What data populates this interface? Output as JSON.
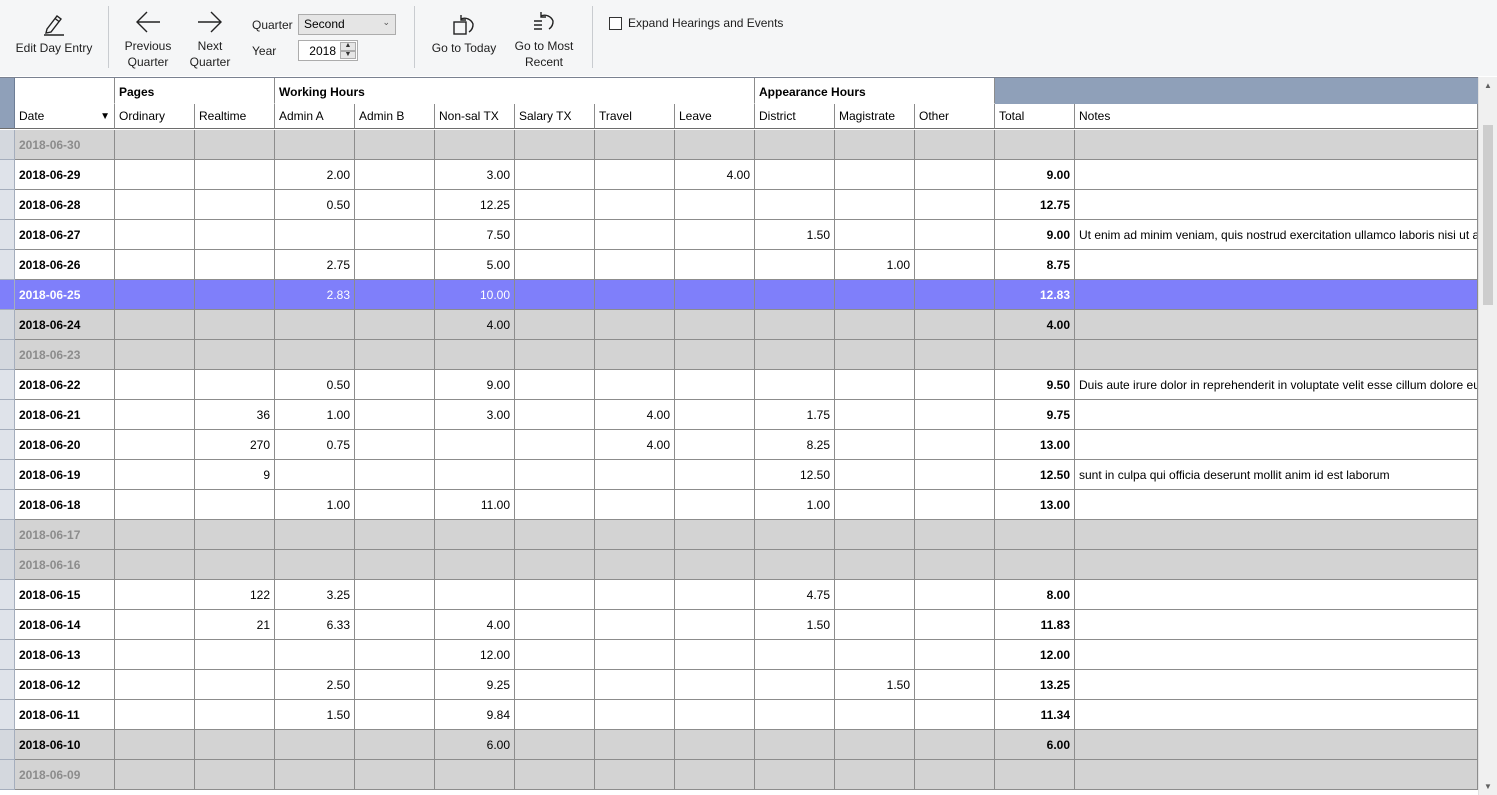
{
  "toolbar": {
    "edit_day_entry": "Edit Day Entry",
    "previous_quarter": "Previous\nQuarter",
    "next_quarter": "Next\nQuarter",
    "quarter_label": "Quarter",
    "quarter_value": "Second",
    "year_label": "Year",
    "year_value": "2018",
    "go_to_today": "Go to Today",
    "go_to_most_recent": "Go to Most\nRecent",
    "expand_label": "Expand Hearings and Events",
    "expand_checked": false
  },
  "groups": {
    "pages": "Pages",
    "working_hours": "Working Hours",
    "appearance_hours": "Appearance Hours"
  },
  "columns": {
    "date": "Date",
    "ordinary": "Ordinary",
    "realtime": "Realtime",
    "admin_a": "Admin A",
    "admin_b": "Admin B",
    "nonsal_tx": "Non-sal TX",
    "salary_tx": "Salary TX",
    "travel": "Travel",
    "leave": "Leave",
    "district": "District",
    "magistrate": "Magistrate",
    "other": "Other",
    "total": "Total",
    "notes": "Notes"
  },
  "colors": {
    "selected_row": "#7f7ffa",
    "weekend_row": "#d3d3d3",
    "group_header_fill": "#8fa0b9"
  },
  "rows": [
    {
      "date": "2018-06-30",
      "weekend": true,
      "empty": true,
      "ordinary": "",
      "realtime": "",
      "admin_a": "",
      "admin_b": "",
      "nonsal_tx": "",
      "salary_tx": "",
      "travel": "",
      "leave": "",
      "district": "",
      "magistrate": "",
      "other": "",
      "total": "",
      "notes": ""
    },
    {
      "date": "2018-06-29",
      "weekend": false,
      "ordinary": "",
      "realtime": "",
      "admin_a": "2.00",
      "admin_b": "",
      "nonsal_tx": "3.00",
      "salary_tx": "",
      "travel": "",
      "leave": "4.00",
      "district": "",
      "magistrate": "",
      "other": "",
      "total": "9.00",
      "notes": ""
    },
    {
      "date": "2018-06-28",
      "weekend": false,
      "ordinary": "",
      "realtime": "",
      "admin_a": "0.50",
      "admin_b": "",
      "nonsal_tx": "12.25",
      "salary_tx": "",
      "travel": "",
      "leave": "",
      "district": "",
      "magistrate": "",
      "other": "",
      "total": "12.75",
      "notes": ""
    },
    {
      "date": "2018-06-27",
      "weekend": false,
      "ordinary": "",
      "realtime": "",
      "admin_a": "",
      "admin_b": "",
      "nonsal_tx": "7.50",
      "salary_tx": "",
      "travel": "",
      "leave": "",
      "district": "1.50",
      "magistrate": "",
      "other": "",
      "total": "9.00",
      "notes": "Ut enim ad minim veniam, quis nostrud exercitation ullamco laboris nisi ut aliquip ex ea commodo consequat"
    },
    {
      "date": "2018-06-26",
      "weekend": false,
      "ordinary": "",
      "realtime": "",
      "admin_a": "2.75",
      "admin_b": "",
      "nonsal_tx": "5.00",
      "salary_tx": "",
      "travel": "",
      "leave": "",
      "district": "",
      "magistrate": "1.00",
      "other": "",
      "total": "8.75",
      "notes": ""
    },
    {
      "date": "2018-06-25",
      "weekend": false,
      "selected": true,
      "ordinary": "",
      "realtime": "",
      "admin_a": "2.83",
      "admin_b": "",
      "nonsal_tx": "10.00",
      "salary_tx": "",
      "travel": "",
      "leave": "",
      "district": "",
      "magistrate": "",
      "other": "",
      "total": "12.83",
      "notes": ""
    },
    {
      "date": "2018-06-24",
      "weekend": true,
      "ordinary": "",
      "realtime": "",
      "admin_a": "",
      "admin_b": "",
      "nonsal_tx": "4.00",
      "salary_tx": "",
      "travel": "",
      "leave": "",
      "district": "",
      "magistrate": "",
      "other": "",
      "total": "4.00",
      "notes": ""
    },
    {
      "date": "2018-06-23",
      "weekend": true,
      "empty": true,
      "ordinary": "",
      "realtime": "",
      "admin_a": "",
      "admin_b": "",
      "nonsal_tx": "",
      "salary_tx": "",
      "travel": "",
      "leave": "",
      "district": "",
      "magistrate": "",
      "other": "",
      "total": "",
      "notes": ""
    },
    {
      "date": "2018-06-22",
      "weekend": false,
      "ordinary": "",
      "realtime": "",
      "admin_a": "0.50",
      "admin_b": "",
      "nonsal_tx": "9.00",
      "salary_tx": "",
      "travel": "",
      "leave": "",
      "district": "",
      "magistrate": "",
      "other": "",
      "total": "9.50",
      "notes": "Duis aute irure dolor in reprehenderit in voluptate velit esse cillum dolore eu fugiat nulla pariatur"
    },
    {
      "date": "2018-06-21",
      "weekend": false,
      "ordinary": "",
      "realtime": "36",
      "admin_a": "1.00",
      "admin_b": "",
      "nonsal_tx": "3.00",
      "salary_tx": "",
      "travel": "4.00",
      "leave": "",
      "district": "1.75",
      "magistrate": "",
      "other": "",
      "total": "9.75",
      "notes": ""
    },
    {
      "date": "2018-06-20",
      "weekend": false,
      "ordinary": "",
      "realtime": "270",
      "admin_a": "0.75",
      "admin_b": "",
      "nonsal_tx": "",
      "salary_tx": "",
      "travel": "4.00",
      "leave": "",
      "district": "8.25",
      "magistrate": "",
      "other": "",
      "total": "13.00",
      "notes": ""
    },
    {
      "date": "2018-06-19",
      "weekend": false,
      "ordinary": "",
      "realtime": "9",
      "admin_a": "",
      "admin_b": "",
      "nonsal_tx": "",
      "salary_tx": "",
      "travel": "",
      "leave": "",
      "district": "12.50",
      "magistrate": "",
      "other": "",
      "total": "12.50",
      "notes": "sunt in culpa qui officia deserunt mollit anim id est laborum"
    },
    {
      "date": "2018-06-18",
      "weekend": false,
      "ordinary": "",
      "realtime": "",
      "admin_a": "1.00",
      "admin_b": "",
      "nonsal_tx": "11.00",
      "salary_tx": "",
      "travel": "",
      "leave": "",
      "district": "1.00",
      "magistrate": "",
      "other": "",
      "total": "13.00",
      "notes": ""
    },
    {
      "date": "2018-06-17",
      "weekend": true,
      "empty": true,
      "ordinary": "",
      "realtime": "",
      "admin_a": "",
      "admin_b": "",
      "nonsal_tx": "",
      "salary_tx": "",
      "travel": "",
      "leave": "",
      "district": "",
      "magistrate": "",
      "other": "",
      "total": "",
      "notes": ""
    },
    {
      "date": "2018-06-16",
      "weekend": true,
      "empty": true,
      "ordinary": "",
      "realtime": "",
      "admin_a": "",
      "admin_b": "",
      "nonsal_tx": "",
      "salary_tx": "",
      "travel": "",
      "leave": "",
      "district": "",
      "magistrate": "",
      "other": "",
      "total": "",
      "notes": ""
    },
    {
      "date": "2018-06-15",
      "weekend": false,
      "ordinary": "",
      "realtime": "122",
      "admin_a": "3.25",
      "admin_b": "",
      "nonsal_tx": "",
      "salary_tx": "",
      "travel": "",
      "leave": "",
      "district": "4.75",
      "magistrate": "",
      "other": "",
      "total": "8.00",
      "notes": ""
    },
    {
      "date": "2018-06-14",
      "weekend": false,
      "ordinary": "",
      "realtime": "21",
      "admin_a": "6.33",
      "admin_b": "",
      "nonsal_tx": "4.00",
      "salary_tx": "",
      "travel": "",
      "leave": "",
      "district": "1.50",
      "magistrate": "",
      "other": "",
      "total": "11.83",
      "notes": ""
    },
    {
      "date": "2018-06-13",
      "weekend": false,
      "ordinary": "",
      "realtime": "",
      "admin_a": "",
      "admin_b": "",
      "nonsal_tx": "12.00",
      "salary_tx": "",
      "travel": "",
      "leave": "",
      "district": "",
      "magistrate": "",
      "other": "",
      "total": "12.00",
      "notes": ""
    },
    {
      "date": "2018-06-12",
      "weekend": false,
      "ordinary": "",
      "realtime": "",
      "admin_a": "2.50",
      "admin_b": "",
      "nonsal_tx": "9.25",
      "salary_tx": "",
      "travel": "",
      "leave": "",
      "district": "",
      "magistrate": "1.50",
      "other": "",
      "total": "13.25",
      "notes": ""
    },
    {
      "date": "2018-06-11",
      "weekend": false,
      "ordinary": "",
      "realtime": "",
      "admin_a": "1.50",
      "admin_b": "",
      "nonsal_tx": "9.84",
      "salary_tx": "",
      "travel": "",
      "leave": "",
      "district": "",
      "magistrate": "",
      "other": "",
      "total": "11.34",
      "notes": ""
    },
    {
      "date": "2018-06-10",
      "weekend": true,
      "ordinary": "",
      "realtime": "",
      "admin_a": "",
      "admin_b": "",
      "nonsal_tx": "6.00",
      "salary_tx": "",
      "travel": "",
      "leave": "",
      "district": "",
      "magistrate": "",
      "other": "",
      "total": "6.00",
      "notes": ""
    },
    {
      "date": "2018-06-09",
      "weekend": true,
      "empty": true,
      "ordinary": "",
      "realtime": "",
      "admin_a": "",
      "admin_b": "",
      "nonsal_tx": "",
      "salary_tx": "",
      "travel": "",
      "leave": "",
      "district": "",
      "magistrate": "",
      "other": "",
      "total": "",
      "notes": ""
    }
  ],
  "icons": {
    "edit": "pen-icon",
    "previous": "arrow-left-icon",
    "next": "arrow-right-icon",
    "today": "rotate-icon",
    "recent": "rotate-list-icon",
    "sort": "sort-descending-icon"
  }
}
